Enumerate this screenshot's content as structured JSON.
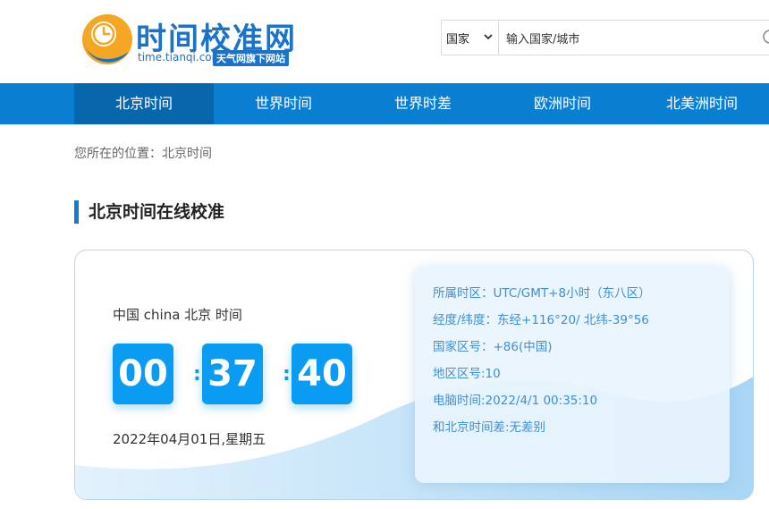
{
  "header": {
    "logo_title": "时间校准网",
    "logo_url": "time.tianqi.com",
    "logo_badge": "天气网旗下网站",
    "search": {
      "select_value": "国家",
      "placeholder": "输入国家/城市"
    }
  },
  "nav": {
    "items": [
      {
        "label": "北京时间",
        "active": true
      },
      {
        "label": "世界时间"
      },
      {
        "label": "世界时差"
      },
      {
        "label": "欧洲时间"
      },
      {
        "label": "北美洲时间"
      }
    ]
  },
  "breadcrumb": "您所在的位置：北京时间",
  "section_title": "北京时间在线校准",
  "clock": {
    "location": "中国 china 北京 时间",
    "hours": "00",
    "minutes": "37",
    "seconds": "40",
    "separator": ":",
    "date": "2022年04月01日,星期五"
  },
  "info": {
    "timezone": "所属时区：UTC/GMT+8小时（东八区）",
    "coords": "经度/纬度：东经+116°20/ 北纬-39°56",
    "country_code": "国家区号：+86(中国)",
    "area_code": "地区区号:10",
    "computer_time": "电脑时间:2022/4/1 00:35:10",
    "diff": "和北京时间差:无差别"
  },
  "colors": {
    "brand": "#1a73c7",
    "nav_bg": "#0a7fd1",
    "nav_active": "#0866ad",
    "digit_bg": "#0a9cf3",
    "info_text": "#3d8fd0"
  }
}
